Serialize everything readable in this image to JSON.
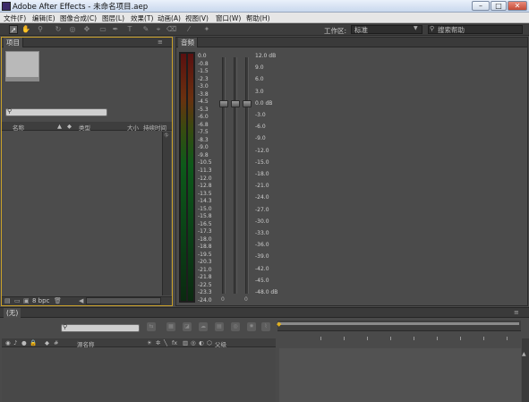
{
  "window": {
    "title": "Adobe After Effects - 未命名项目.aep",
    "minimize": "–",
    "maximize": "□",
    "close": "✕"
  },
  "menu": [
    "文件(F)",
    "编辑(E)",
    "图像合成(C)",
    "图层(L)",
    "效果(T)",
    "动画(A)",
    "视图(V)",
    "窗口(W)",
    "帮助(H)"
  ],
  "toolbar": {
    "workspace_label": "工作区:",
    "workspace_value": "标准",
    "search_placeholder": "搜索帮助"
  },
  "project_panel": {
    "tab": "项目",
    "menu_glyph": "≡",
    "columns": {
      "name": "名称",
      "type": "类型",
      "size": "大小",
      "duration": "持续时间"
    },
    "bit_depth": "8 bpc"
  },
  "audio_panel": {
    "tab": "音频",
    "left_scale": [
      "0.0",
      "-0.8",
      "-1.5",
      "-2.3",
      "-3.0",
      "-3.8",
      "-4.5",
      "-5.3",
      "-6.0",
      "-6.8",
      "-7.5",
      "-8.3",
      "-9.0",
      "-9.8",
      "-10.5",
      "-11.3",
      "-12.0",
      "-12.8",
      "-13.5",
      "-14.3",
      "-15.0",
      "-15.8",
      "-16.5",
      "-17.3",
      "-18.0",
      "-18.8",
      "-19.5",
      "-20.3",
      "-21.0",
      "-21.8",
      "-22.5",
      "-23.3",
      "-24.0"
    ],
    "right_scale": [
      "12.0 dB",
      "9.0",
      "6.0",
      "3.0",
      "0.0 dB",
      "-3.0",
      "-6.0",
      "-9.0",
      "-12.0",
      "-15.0",
      "-18.0",
      "-21.0",
      "-24.0",
      "-27.0",
      "-30.0",
      "-33.0",
      "-36.0",
      "-39.0",
      "-42.0",
      "-45.0",
      "-48.0 dB"
    ],
    "zero_labels": [
      "0",
      "0"
    ],
    "slider_level_db": 0.0
  },
  "timeline_panel": {
    "tab": "(无)",
    "columns": {
      "layer_name": "源名称",
      "parent": "父级"
    }
  }
}
